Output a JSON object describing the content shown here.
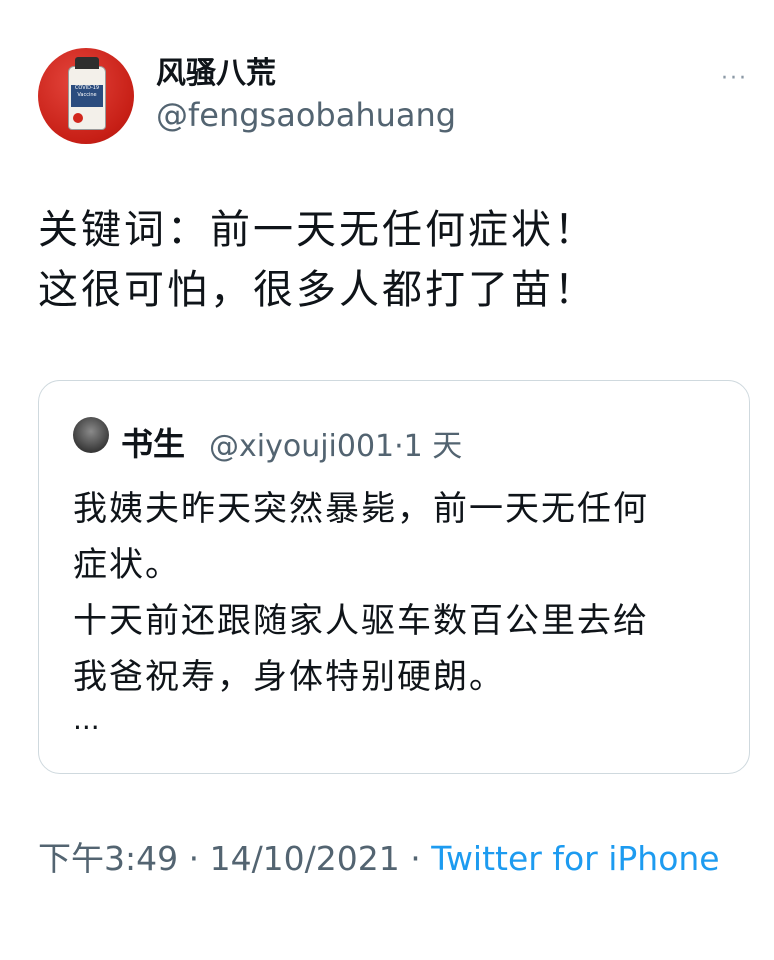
{
  "author": {
    "display_name": "风骚八荒",
    "handle": "@fengsaobahuang",
    "avatar_icon": "covid-vaccine-avatar-icon",
    "avatar_label": "COVID-19 Vaccine"
  },
  "more_icon": "···",
  "tweet": {
    "line1": "关键词：前一天无任何症状！",
    "line2": "这很可怕，很多人都打了苗！"
  },
  "quoted": {
    "display_name": "书生",
    "meta": "@xiyouji001·1 天",
    "lines": [
      "我姨夫昨天突然暴毙，前一天无任何",
      "症状。",
      "十天前还跟随家人驱车数百公里去给",
      "我爸祝寿，身体特别硬朗。"
    ],
    "ellipsis": "..."
  },
  "footer": {
    "timestamp": "下午3:49 · 14/10/2021 · ",
    "source": "Twitter for iPhone"
  },
  "colors": {
    "link": "#1d9bf0",
    "secondary": "#536471",
    "border": "#cfd9de"
  }
}
